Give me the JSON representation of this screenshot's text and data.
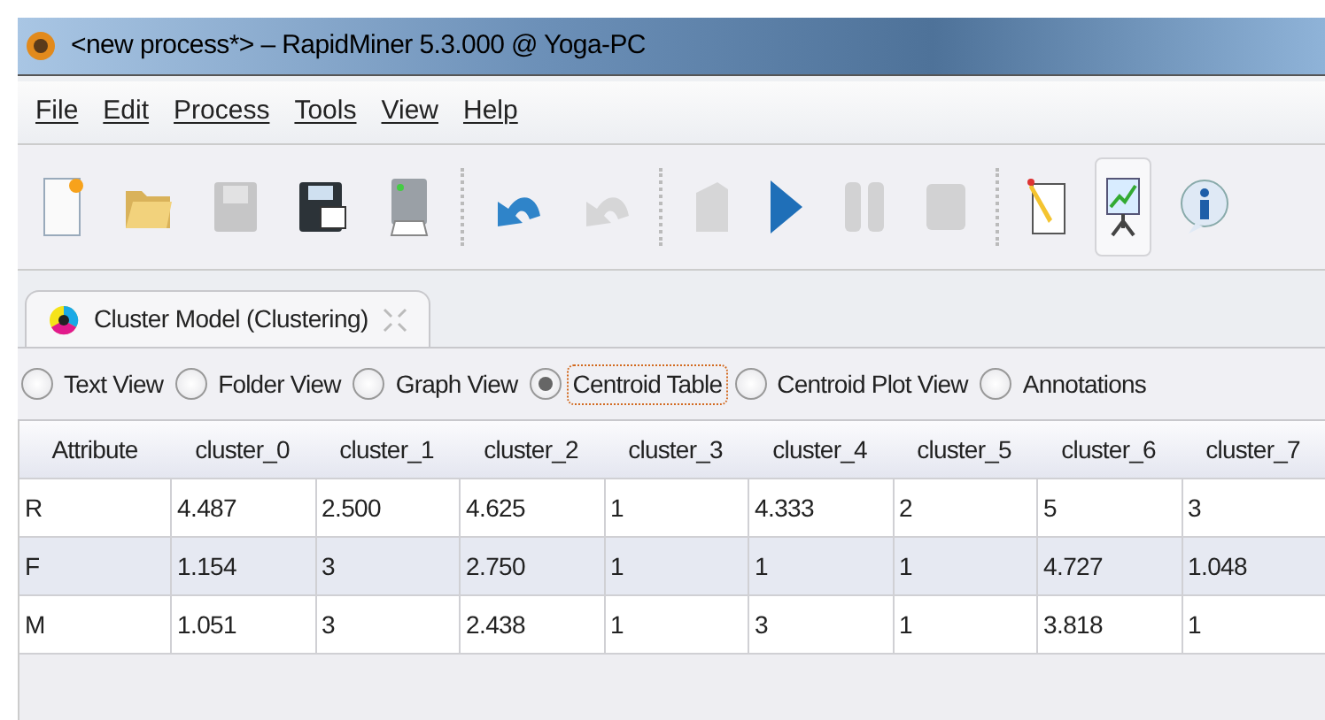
{
  "window": {
    "title": "<new process*> – RapidMiner 5.3.000 @ Yoga-PC"
  },
  "menu": [
    "File",
    "Edit",
    "Process",
    "Tools",
    "View",
    "Help"
  ],
  "toolbar": [
    {
      "kind": "new",
      "disabled": false,
      "pressed": false
    },
    {
      "kind": "open",
      "disabled": false,
      "pressed": false
    },
    {
      "kind": "save",
      "disabled": true,
      "pressed": false
    },
    {
      "kind": "save-as",
      "disabled": false,
      "pressed": false
    },
    {
      "kind": "print",
      "disabled": false,
      "pressed": false
    },
    {
      "kind": "sep"
    },
    {
      "kind": "undo",
      "disabled": false,
      "pressed": false
    },
    {
      "kind": "redo",
      "disabled": true,
      "pressed": false
    },
    {
      "kind": "sep"
    },
    {
      "kind": "validate",
      "disabled": true,
      "pressed": false
    },
    {
      "kind": "run",
      "disabled": false,
      "pressed": false
    },
    {
      "kind": "pause",
      "disabled": true,
      "pressed": false
    },
    {
      "kind": "stop",
      "disabled": true,
      "pressed": false
    },
    {
      "kind": "sep"
    },
    {
      "kind": "design",
      "disabled": false,
      "pressed": false
    },
    {
      "kind": "results",
      "disabled": false,
      "pressed": true
    },
    {
      "kind": "info",
      "disabled": false,
      "pressed": false
    }
  ],
  "tab": {
    "label": "Cluster Model (Clustering)"
  },
  "views": [
    {
      "label": "Text View",
      "selected": false
    },
    {
      "label": "Folder View",
      "selected": false
    },
    {
      "label": "Graph View",
      "selected": false
    },
    {
      "label": "Centroid Table",
      "selected": true
    },
    {
      "label": "Centroid Plot View",
      "selected": false
    },
    {
      "label": "Annotations",
      "selected": false
    }
  ],
  "table": {
    "columns": [
      "Attribute",
      "cluster_0",
      "cluster_1",
      "cluster_2",
      "cluster_3",
      "cluster_4",
      "cluster_5",
      "cluster_6",
      "cluster_7"
    ],
    "rows": [
      [
        "R",
        "4.487",
        "2.500",
        "4.625",
        "1",
        "4.333",
        "2",
        "5",
        "3"
      ],
      [
        "F",
        "1.154",
        "3",
        "2.750",
        "1",
        "1",
        "1",
        "4.727",
        "1.048"
      ],
      [
        "M",
        "1.051",
        "3",
        "2.438",
        "1",
        "3",
        "1",
        "3.818",
        "1"
      ]
    ]
  }
}
